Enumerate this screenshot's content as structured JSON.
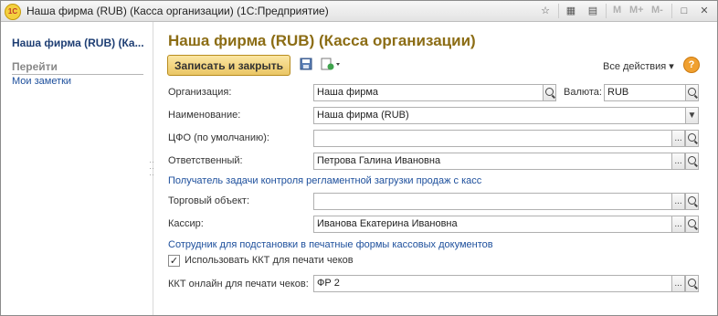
{
  "window": {
    "title": "Наша фирма (RUB) (Касса организации)  (1С:Предприятие)",
    "logo_text": "1С",
    "toolbar_m": [
      "M",
      "M+",
      "M-"
    ],
    "restore_glyph": "□",
    "close_glyph": "✕"
  },
  "sidebar": {
    "title": "Наша фирма (RUB) (Ка...",
    "section": "Перейти",
    "link": "Мои заметки"
  },
  "main": {
    "page_title": "Наша фирма (RUB) (Касса организации)",
    "save_close_label": "Записать и закрыть",
    "all_actions_label": "Все действия",
    "help_glyph": "?",
    "fields": {
      "organization": {
        "label": "Организация:",
        "value": "Наша фирма"
      },
      "currency": {
        "label": "Валюта:",
        "value": "RUB"
      },
      "name": {
        "label": "Наименование:",
        "value": "Наша фирма (RUB)"
      },
      "cfo": {
        "label": "ЦФО (по умолчанию):",
        "value": ""
      },
      "responsible": {
        "label": "Ответственный:",
        "value": "Петрова Галина Ивановна"
      },
      "trade_object": {
        "label": "Торговый объект:",
        "value": ""
      },
      "cashier": {
        "label": "Кассир:",
        "value": "Иванова Екатерина Ивановна"
      },
      "kkt": {
        "label": "ККТ онлайн для печати чеков:",
        "value": "ФР 2"
      }
    },
    "section_receiver": "Получатель задачи контроля регламентной загрузки продаж с касс",
    "section_employee": "Сотрудник для подстановки в печатные формы кассовых документов",
    "use_kkt_label": "Использовать ККТ для печати чеков",
    "use_kkt_checked": true,
    "ellipsis": "...",
    "dropdown_glyph": "▼",
    "check_glyph": "✓"
  }
}
